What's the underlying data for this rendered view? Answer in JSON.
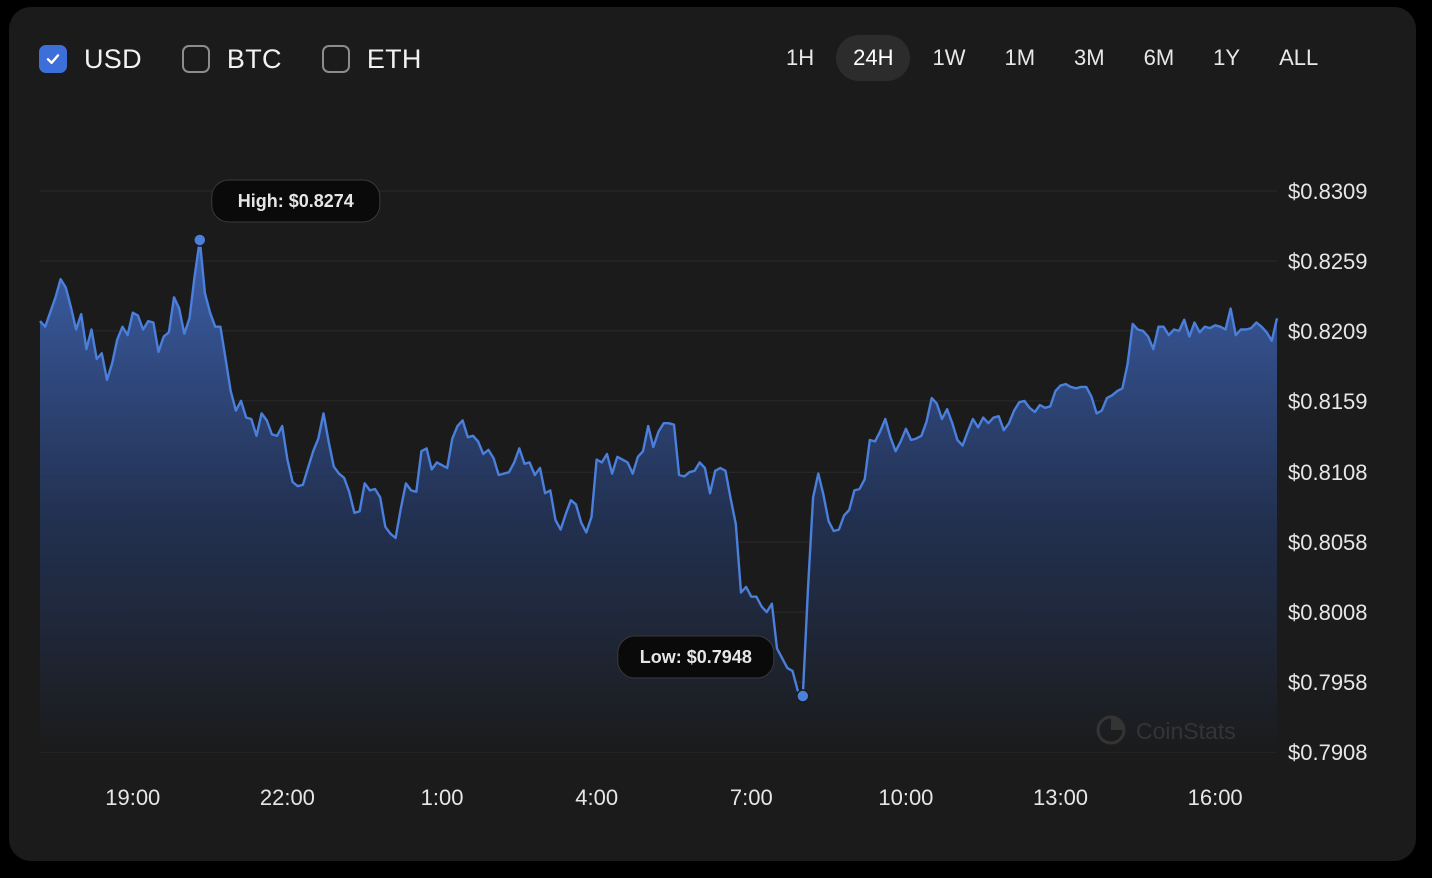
{
  "currency_options": [
    {
      "label": "USD",
      "checked": true
    },
    {
      "label": "BTC",
      "checked": false
    },
    {
      "label": "ETH",
      "checked": false
    }
  ],
  "time_ranges": [
    {
      "label": "1H",
      "active": false
    },
    {
      "label": "24H",
      "active": true
    },
    {
      "label": "1W",
      "active": false
    },
    {
      "label": "1M",
      "active": false
    },
    {
      "label": "3M",
      "active": false
    },
    {
      "label": "6M",
      "active": false
    },
    {
      "label": "1Y",
      "active": false
    },
    {
      "label": "ALL",
      "active": false
    }
  ],
  "watermark": "CoinStats",
  "colors": {
    "line": "#4a7fdc",
    "accent": "#3d6fdb",
    "background": "#1b1b1b"
  },
  "chart_data": {
    "type": "area",
    "x_start_hour": 17.2,
    "x_end_hour": 41.2,
    "x_tick_hours": [
      19,
      22,
      25,
      28,
      31,
      34,
      37,
      40
    ],
    "x_tick_labels": [
      "19:00",
      "22:00",
      "1:00",
      "4:00",
      "7:00",
      "10:00",
      "13:00",
      "16:00"
    ],
    "y_ticks": [
      0.8309,
      0.8259,
      0.8209,
      0.8159,
      0.8108,
      0.8058,
      0.8008,
      0.7958,
      0.7908
    ],
    "y_tick_labels": [
      "$0.8309",
      "$0.8259",
      "$0.8209",
      "$0.8159",
      "$0.8108",
      "$0.8058",
      "$0.8008",
      "$0.7958",
      "$0.7908"
    ],
    "ylim": [
      0.7908,
      0.8309
    ],
    "grid": true,
    "high": {
      "label": "High: $0.8274",
      "hour": 20.3,
      "value": 0.8274
    },
    "low": {
      "label": "Low: $0.7948",
      "hour": 7.4,
      "value": 0.7948
    },
    "series": [
      {
        "points": [
          [
            17.2,
            0.8216
          ],
          [
            17.3,
            0.8212
          ],
          [
            17.5,
            0.8233
          ],
          [
            17.6,
            0.8246
          ],
          [
            17.7,
            0.824
          ],
          [
            17.8,
            0.8226
          ],
          [
            17.9,
            0.821
          ],
          [
            18.0,
            0.8221
          ],
          [
            18.1,
            0.8196
          ],
          [
            18.2,
            0.821
          ],
          [
            18.3,
            0.8189
          ],
          [
            18.4,
            0.8193
          ],
          [
            18.5,
            0.8174
          ],
          [
            18.6,
            0.8186
          ],
          [
            18.7,
            0.8203
          ],
          [
            18.8,
            0.8212
          ],
          [
            18.9,
            0.8206
          ],
          [
            19.0,
            0.8222
          ],
          [
            19.1,
            0.822
          ],
          [
            19.2,
            0.821
          ],
          [
            19.3,
            0.8216
          ],
          [
            19.4,
            0.8215
          ],
          [
            19.5,
            0.8194
          ],
          [
            19.6,
            0.8205
          ],
          [
            19.7,
            0.8208
          ],
          [
            19.8,
            0.8233
          ],
          [
            19.9,
            0.8225
          ],
          [
            20.0,
            0.8207
          ],
          [
            20.1,
            0.8218
          ],
          [
            20.2,
            0.8248
          ],
          [
            20.3,
            0.8274
          ],
          [
            20.4,
            0.8236
          ],
          [
            20.5,
            0.8222
          ],
          [
            20.6,
            0.8212
          ],
          [
            20.7,
            0.8212
          ],
          [
            20.8,
            0.8189
          ],
          [
            20.9,
            0.8166
          ],
          [
            21.0,
            0.8152
          ],
          [
            21.1,
            0.8159
          ],
          [
            21.2,
            0.8147
          ],
          [
            21.3,
            0.8146
          ],
          [
            21.4,
            0.8134
          ],
          [
            21.5,
            0.815
          ],
          [
            21.6,
            0.8145
          ],
          [
            21.7,
            0.8135
          ],
          [
            21.8,
            0.8134
          ],
          [
            21.9,
            0.8141
          ],
          [
            22.0,
            0.8117
          ],
          [
            22.1,
            0.8101
          ],
          [
            22.2,
            0.8098
          ],
          [
            22.3,
            0.8099
          ],
          [
            22.4,
            0.8111
          ],
          [
            22.5,
            0.8123
          ],
          [
            22.6,
            0.8132
          ],
          [
            22.7,
            0.815
          ],
          [
            22.8,
            0.813
          ],
          [
            22.9,
            0.8112
          ],
          [
            23.0,
            0.8107
          ],
          [
            23.1,
            0.8104
          ],
          [
            23.2,
            0.8094
          ],
          [
            23.3,
            0.8079
          ],
          [
            23.4,
            0.808
          ],
          [
            23.5,
            0.81
          ],
          [
            23.6,
            0.8095
          ],
          [
            23.7,
            0.8096
          ],
          [
            23.8,
            0.809
          ],
          [
            23.9,
            0.8069
          ],
          [
            24.0,
            0.8064
          ],
          [
            24.1,
            0.8061
          ],
          [
            24.2,
            0.8082
          ],
          [
            24.3,
            0.81
          ],
          [
            24.4,
            0.8095
          ],
          [
            24.5,
            0.8094
          ],
          [
            24.6,
            0.8123
          ],
          [
            24.7,
            0.8125
          ],
          [
            24.8,
            0.811
          ],
          [
            24.9,
            0.8115
          ],
          [
            25.0,
            0.8113
          ],
          [
            25.1,
            0.8111
          ],
          [
            25.2,
            0.8132
          ],
          [
            25.3,
            0.8141
          ],
          [
            25.4,
            0.8145
          ],
          [
            25.5,
            0.8133
          ],
          [
            25.6,
            0.8134
          ],
          [
            25.7,
            0.813
          ],
          [
            25.8,
            0.8121
          ],
          [
            25.9,
            0.8124
          ],
          [
            26.0,
            0.8118
          ],
          [
            26.1,
            0.8106
          ],
          [
            26.2,
            0.8107
          ],
          [
            26.3,
            0.8108
          ],
          [
            26.4,
            0.8115
          ],
          [
            26.5,
            0.8125
          ],
          [
            26.6,
            0.8114
          ],
          [
            26.7,
            0.8115
          ],
          [
            26.8,
            0.8106
          ],
          [
            26.9,
            0.8111
          ],
          [
            27.0,
            0.8093
          ],
          [
            27.1,
            0.8095
          ],
          [
            27.2,
            0.8074
          ],
          [
            27.3,
            0.8067
          ],
          [
            27.4,
            0.8078
          ],
          [
            27.5,
            0.8088
          ],
          [
            27.6,
            0.8085
          ],
          [
            27.7,
            0.8072
          ],
          [
            27.8,
            0.8065
          ],
          [
            27.9,
            0.8076
          ],
          [
            28.0,
            0.8117
          ],
          [
            28.1,
            0.8115
          ],
          [
            28.2,
            0.8121
          ],
          [
            28.3,
            0.8107
          ],
          [
            28.4,
            0.8119
          ],
          [
            28.5,
            0.8117
          ],
          [
            28.6,
            0.8115
          ],
          [
            28.7,
            0.8107
          ],
          [
            28.8,
            0.8119
          ],
          [
            28.9,
            0.8123
          ],
          [
            29.0,
            0.8141
          ],
          [
            29.1,
            0.8126
          ],
          [
            29.2,
            0.8137
          ],
          [
            29.3,
            0.8143
          ],
          [
            29.4,
            0.8143
          ],
          [
            29.5,
            0.8142
          ],
          [
            29.6,
            0.8106
          ],
          [
            29.7,
            0.8105
          ],
          [
            29.8,
            0.8108
          ],
          [
            29.9,
            0.8109
          ],
          [
            30.0,
            0.8115
          ],
          [
            30.1,
            0.8111
          ],
          [
            30.2,
            0.8093
          ],
          [
            30.3,
            0.8109
          ],
          [
            30.4,
            0.8111
          ],
          [
            30.5,
            0.8109
          ],
          [
            30.6,
            0.8089
          ],
          [
            30.7,
            0.8071
          ],
          [
            30.8,
            0.8022
          ],
          [
            30.9,
            0.8026
          ],
          [
            31.0,
            0.8019
          ],
          [
            31.1,
            0.8019
          ],
          [
            31.2,
            0.8012
          ],
          [
            31.3,
            0.8008
          ],
          [
            31.4,
            0.8014
          ],
          [
            31.5,
            0.7982
          ],
          [
            31.6,
            0.7975
          ],
          [
            31.7,
            0.7968
          ],
          [
            31.8,
            0.7966
          ],
          [
            31.9,
            0.7952
          ],
          [
            32.0,
            0.7948
          ],
          [
            32.1,
            0.8025
          ],
          [
            32.2,
            0.809
          ],
          [
            32.3,
            0.8107
          ],
          [
            32.4,
            0.8092
          ],
          [
            32.5,
            0.8073
          ],
          [
            32.6,
            0.8066
          ],
          [
            32.7,
            0.8067
          ],
          [
            32.8,
            0.8077
          ],
          [
            32.9,
            0.8081
          ],
          [
            33.0,
            0.8095
          ],
          [
            33.1,
            0.8096
          ],
          [
            33.2,
            0.8103
          ],
          [
            33.3,
            0.8131
          ],
          [
            33.4,
            0.813
          ],
          [
            33.5,
            0.8137
          ],
          [
            33.6,
            0.8146
          ],
          [
            33.7,
            0.8133
          ],
          [
            33.8,
            0.8123
          ],
          [
            33.9,
            0.813
          ],
          [
            34.0,
            0.8139
          ],
          [
            34.1,
            0.8131
          ],
          [
            34.2,
            0.8132
          ],
          [
            34.3,
            0.8134
          ],
          [
            34.4,
            0.8144
          ],
          [
            34.5,
            0.8161
          ],
          [
            34.6,
            0.8157
          ],
          [
            34.7,
            0.8146
          ],
          [
            34.8,
            0.8153
          ],
          [
            34.9,
            0.8143
          ],
          [
            35.0,
            0.8131
          ],
          [
            35.1,
            0.8127
          ],
          [
            35.2,
            0.8137
          ],
          [
            35.3,
            0.8146
          ],
          [
            35.4,
            0.814
          ],
          [
            35.5,
            0.8147
          ],
          [
            35.6,
            0.8143
          ],
          [
            35.7,
            0.8147
          ],
          [
            35.8,
            0.8148
          ],
          [
            35.9,
            0.8138
          ],
          [
            36.0,
            0.8143
          ],
          [
            36.1,
            0.8152
          ],
          [
            36.2,
            0.8158
          ],
          [
            36.3,
            0.8159
          ],
          [
            36.4,
            0.8154
          ],
          [
            36.5,
            0.8151
          ],
          [
            36.6,
            0.8156
          ],
          [
            36.7,
            0.8154
          ],
          [
            36.8,
            0.8155
          ],
          [
            36.9,
            0.8166
          ],
          [
            37.0,
            0.817
          ],
          [
            37.1,
            0.8171
          ],
          [
            37.2,
            0.8169
          ],
          [
            37.3,
            0.8168
          ],
          [
            37.4,
            0.8169
          ],
          [
            37.5,
            0.8169
          ],
          [
            37.6,
            0.8162
          ],
          [
            37.7,
            0.815
          ],
          [
            37.8,
            0.8152
          ],
          [
            37.9,
            0.8161
          ],
          [
            38.0,
            0.8163
          ],
          [
            38.1,
            0.8166
          ],
          [
            38.2,
            0.8168
          ],
          [
            38.3,
            0.8185
          ],
          [
            38.4,
            0.8214
          ],
          [
            38.5,
            0.821
          ],
          [
            38.6,
            0.8209
          ],
          [
            38.7,
            0.8205
          ],
          [
            38.8,
            0.8196
          ],
          [
            38.9,
            0.8212
          ],
          [
            39.0,
            0.8212
          ],
          [
            39.1,
            0.8206
          ],
          [
            39.2,
            0.821
          ],
          [
            39.3,
            0.8209
          ],
          [
            39.4,
            0.8217
          ],
          [
            39.5,
            0.8205
          ],
          [
            39.6,
            0.8215
          ],
          [
            39.7,
            0.8208
          ],
          [
            39.8,
            0.8212
          ],
          [
            39.9,
            0.8211
          ],
          [
            40.0,
            0.8213
          ],
          [
            40.1,
            0.8212
          ],
          [
            40.2,
            0.821
          ],
          [
            40.3,
            0.8225
          ],
          [
            40.4,
            0.8206
          ],
          [
            40.5,
            0.821
          ],
          [
            40.6,
            0.821
          ],
          [
            40.7,
            0.8211
          ],
          [
            40.8,
            0.8215
          ],
          [
            40.9,
            0.8212
          ],
          [
            41.0,
            0.8208
          ],
          [
            41.1,
            0.8202
          ],
          [
            41.2,
            0.8218
          ]
        ]
      }
    ]
  }
}
